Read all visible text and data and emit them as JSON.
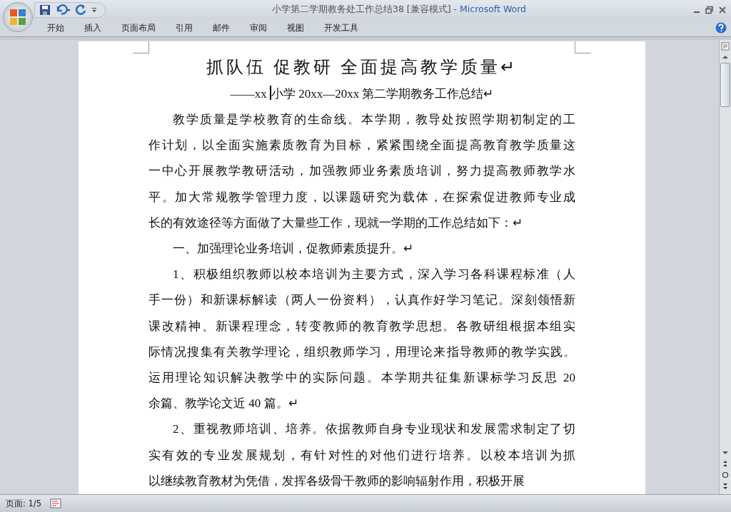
{
  "window": {
    "title": "小学第二学期教务处工作总结38 [兼容模式]",
    "app": "- Microsoft Word"
  },
  "tabs": [
    {
      "label": "开始"
    },
    {
      "label": "插入"
    },
    {
      "label": "页面布局"
    },
    {
      "label": "引用"
    },
    {
      "label": "邮件"
    },
    {
      "label": "审阅"
    },
    {
      "label": "视图"
    },
    {
      "label": "开发工具"
    }
  ],
  "document": {
    "title": "抓队伍 促教研 全面提高教学质量↵",
    "subtitle": {
      "before_cursor": "——xx ",
      "after_cursor": "小学 20xx—20xx 第二学期教务工作总结↵"
    },
    "paragraphs": [
      {
        "lines": [
          "教学质量是学校教育的生命线。本学期，教导处按照学期初制定的工",
          "作计划，以全面实施素质教育为目标，紧紧围绕全面提高教育教学质量这",
          "一中心开展教学教研活动，加强教师业务素质培训，努力提高教师教学水",
          "平。加大常规教学管理力度，以课题研究为载体，在探索促进教师专业成",
          "长的有效途径等方面做了大量些工作，现就一学期的工作总结如下：↵"
        ]
      },
      {
        "lines": [
          "一、加强理论业务培训，促教师素质提升。↵"
        ]
      },
      {
        "lines": [
          "1、积极组织教师以校本培训为主要方式，深入学习各科课程标准（人",
          "手一份）和新课标解读（两人一份资料），认真作好学习笔记。深刻领悟新",
          "课改精神、新课程理念，转变教师的教育教学思想。各教研组根据本组实",
          "际情况搜集有关教学理论，组织教师学习，用理论来指导教师的教学实践。",
          "运用理论知识解决教学中的实际问题。本学期共征集新课标学习反思 20",
          "余篇、教学论文近 40 篇。↵"
        ]
      },
      {
        "lines": [
          "2、重视教师培训、培养。依据教师自身专业现状和发展需求制定了切",
          "实有效的专业发展规划，有针对性的对他们进行培养。以校本培训为抓",
          "以继续教育教材为凭借，发挥各级骨干教师的影响辐射作用，积极开展"
        ]
      }
    ]
  },
  "status_bar": {
    "page": "页面: 1/5"
  }
}
